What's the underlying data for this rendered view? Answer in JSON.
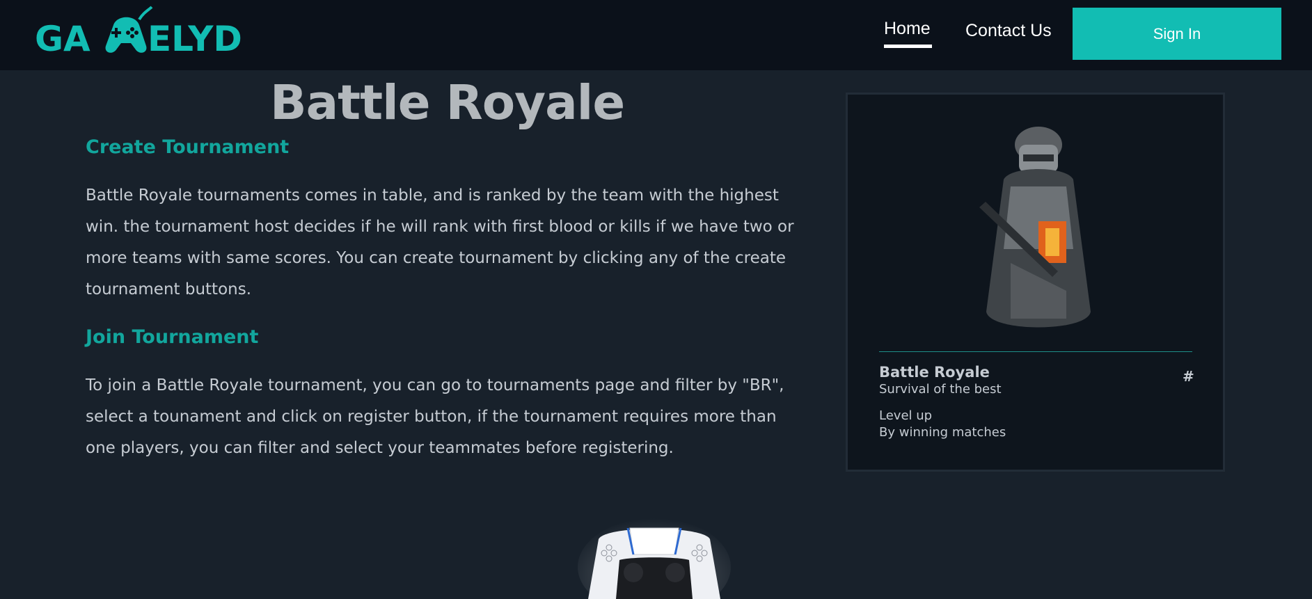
{
  "header": {
    "logo_text": "GAMELYD",
    "nav": {
      "home_label": "Home",
      "contact_label": "Contact Us",
      "signin_label": "Sign In"
    }
  },
  "main": {
    "title": "Battle Royale",
    "sections": [
      {
        "heading": "Create Tournament",
        "body": "Battle Royale tournaments comes in table, and is ranked by the team with the highest win. the tournament host decides if he will rank with first blood or kills if we have two or more teams with same scores. You can create tournament by clicking any of the create tournament buttons."
      },
      {
        "heading": "Join Tournament",
        "body": "To join a Battle Royale tournament, you can go to tournaments page and filter by \"BR\", select a tounament and click on register button, if the tournament requires more than one players, you can filter and select your teammates before registering."
      }
    ]
  },
  "card": {
    "title": "Battle Royale",
    "subtitle": "Survival of the best",
    "hash": "#",
    "level_title": "Level up",
    "level_sub": "By winning matches",
    "image": "soldier-image"
  },
  "colors": {
    "accent": "#12bdb3",
    "heading": "#12a69d",
    "background": "#18212b",
    "header_bg": "#0b111a"
  }
}
